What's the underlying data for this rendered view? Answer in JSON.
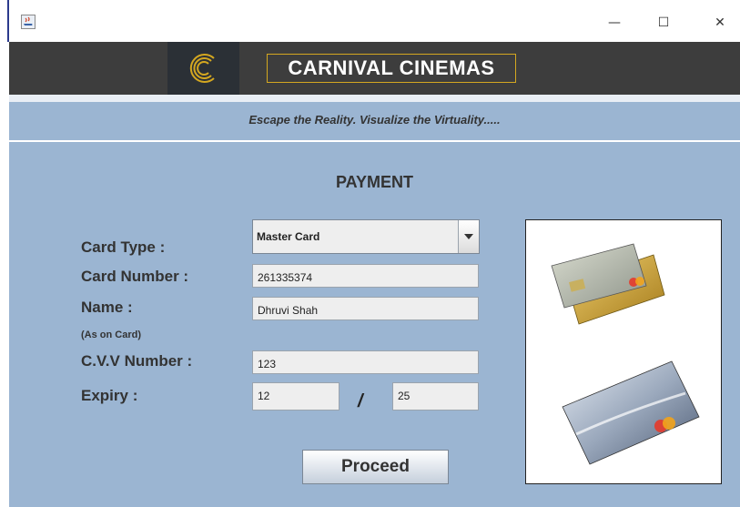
{
  "window": {
    "minimize_glyph": "—",
    "maximize_glyph": "☐",
    "close_glyph": "✕"
  },
  "header": {
    "brand": "CARNIVAL CINEMAS"
  },
  "tagline": "Escape the Reality. Visualize the Virtuality.....",
  "payment": {
    "title": "PAYMENT",
    "labels": {
      "card_type": "Card Type :",
      "card_number": "Card Number :",
      "name": "Name :",
      "as_on_card": "(As on Card)",
      "cvv": "C.V.V Number :",
      "expiry": "Expiry :"
    },
    "card_type_value": "Master Card",
    "card_number_value": "261335374",
    "name_value": "Dhruvi Shah",
    "cvv_value": "123",
    "expiry_month": "12",
    "expiry_separator": "/",
    "expiry_year": "25",
    "proceed_label": "Proceed"
  },
  "colors": {
    "header_bg": "#3d3d3d",
    "accent_gold": "#d4a720",
    "panel_bg": "#9bb5d2"
  }
}
